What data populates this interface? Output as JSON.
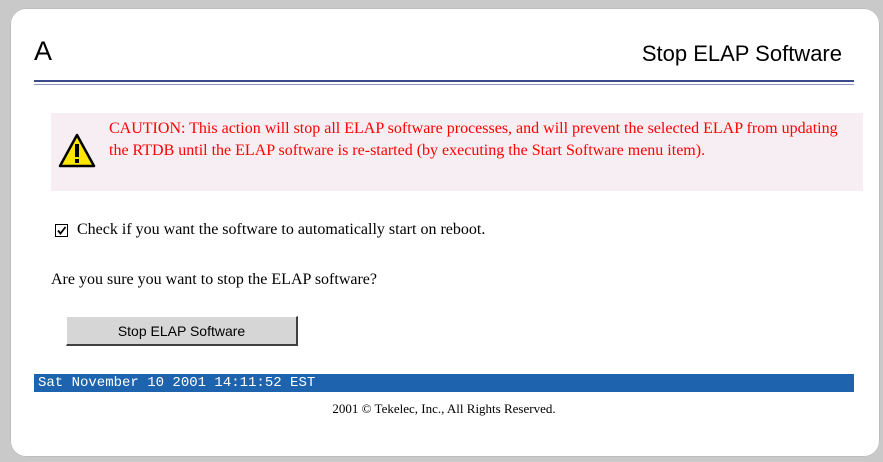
{
  "header": {
    "server_letter": "A",
    "title": "Stop ELAP Software"
  },
  "caution": {
    "icon": "warning-icon",
    "text": "CAUTION: This action will stop all ELAP software processes, and will prevent the selected ELAP from updating the RTDB until the ELAP software is re-started (by executing the Start Software menu item).",
    "color": "#ff0000"
  },
  "autostart": {
    "checked": true,
    "label": "Check if you want the software to automatically start on reboot."
  },
  "question": "Are you sure you want to stop the ELAP software?",
  "stop_button_label": "Stop ELAP Software",
  "status_bar": {
    "datetime": "Sat November 10 2001 14:11:52 EST",
    "color": "#1d63ad"
  },
  "footer": {
    "copyright": "2001 © Tekelec, Inc., All Rights Reserved."
  }
}
